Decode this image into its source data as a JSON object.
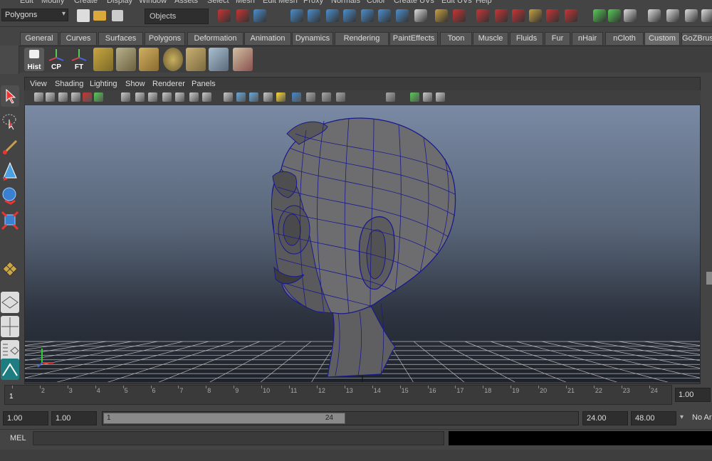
{
  "menubar": [
    "Edit",
    "Modify",
    "Create",
    "Display",
    "Window",
    "Assets",
    "Select",
    "Mesh",
    "Edit Mesh",
    "Proxy",
    "Normals",
    "Color",
    "Create UVs",
    "Edit UVs",
    "Help"
  ],
  "statusline": {
    "mode": "Polygons",
    "object_selector": "Objects"
  },
  "shelf_tabs": [
    "General",
    "Curves",
    "Surfaces",
    "Polygons",
    "Deformation",
    "Animation",
    "Dynamics",
    "Rendering",
    "PaintEffects",
    "Toon",
    "Muscle",
    "Fluids",
    "Fur",
    "nHair",
    "nCloth",
    "Custom",
    "GoZBrush"
  ],
  "active_shelf_tab": "Custom",
  "shelf_icons": [
    {
      "label": "Hist",
      "icon": "history-toggle-icon"
    },
    {
      "label": "CP",
      "icon": "center-pivot-icon"
    },
    {
      "label": "FT",
      "icon": "freeze-transforms-icon"
    }
  ],
  "panel_menu": [
    "View",
    "Shading",
    "Lighting",
    "Show",
    "Renderer",
    "Panels"
  ],
  "timeline": {
    "ticks": [
      "1",
      "2",
      "3",
      "4",
      "5",
      "6",
      "7",
      "8",
      "9",
      "10",
      "11",
      "12",
      "13",
      "14",
      "15",
      "16",
      "17",
      "18",
      "19",
      "20",
      "21",
      "22",
      "23",
      "24"
    ],
    "current_frame_marker": "1",
    "current_time": "1.00"
  },
  "range": {
    "start_time": "1.00",
    "playback_start": "1.00",
    "slider_start": "1",
    "slider_end": "24",
    "playback_end": "24.00",
    "end_time": "48.00",
    "anim_layer": "No Ar"
  },
  "command": {
    "label": "MEL"
  },
  "colors": {
    "accent": "#6a6a6a",
    "wireframe": "#1a1a8c",
    "grid": "#b8b8b8"
  }
}
